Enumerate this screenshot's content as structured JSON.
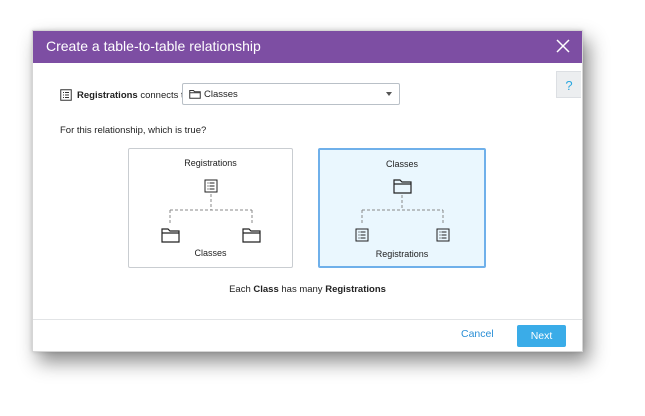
{
  "dialog": {
    "title": "Create a table-to-table relationship",
    "help_label": "?"
  },
  "connect": {
    "source_table": "Registrations",
    "connects_to": "connects to",
    "selected_table": "Classes"
  },
  "question": "For this relationship, which is true?",
  "options": [
    {
      "parent": "Classes",
      "child": "Registrations",
      "selected": false
    },
    {
      "parent": "Classes",
      "child": "Registrations",
      "selected": true
    }
  ],
  "option_labels": {
    "card1_top": "Registrations",
    "card1_bottom": "Classes",
    "card2_top": "Classes",
    "card2_bottom": "Registrations"
  },
  "summary": {
    "prefix": "Each",
    "parent": "Class",
    "middle": "has many",
    "child": "Registrations"
  },
  "footer": {
    "cancel_label": "Cancel",
    "next_label": "Next"
  },
  "colors": {
    "titlebar": "#7d4ea3",
    "selected_border": "#6fb0ea",
    "selected_bg": "#eaf7fe",
    "accent": "#3aace8"
  }
}
